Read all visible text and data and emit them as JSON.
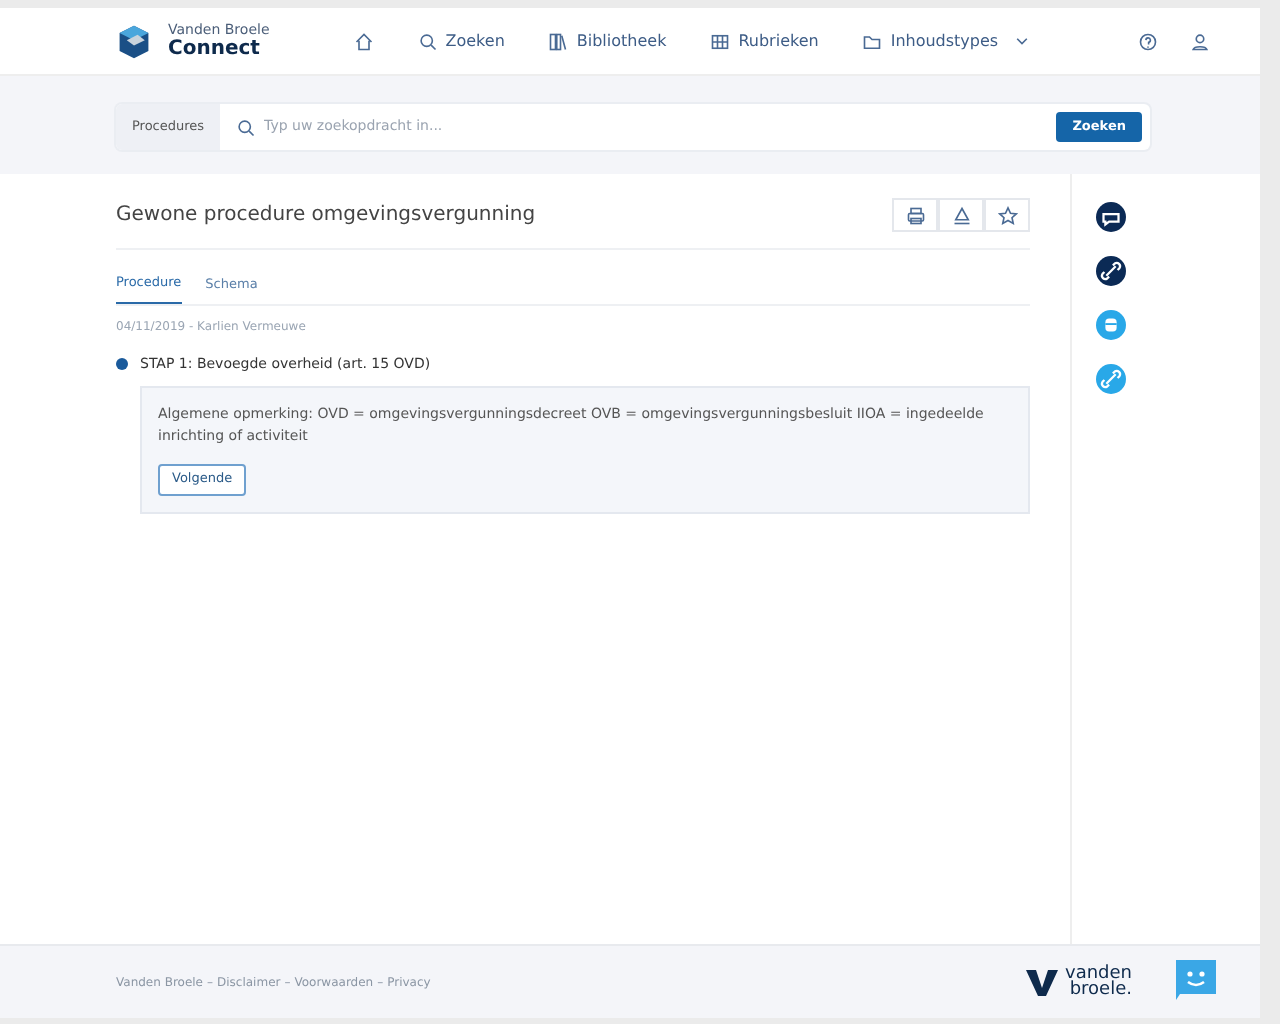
{
  "brand": {
    "line1": "Vanden Broele",
    "line2": "Connect"
  },
  "nav": [
    {
      "kind": "home"
    },
    {
      "kind": "search",
      "label": "Zoeken"
    },
    {
      "kind": "book",
      "label": "Bibliotheek"
    },
    {
      "kind": "grid",
      "label": "Rubrieken"
    },
    {
      "kind": "folder",
      "label": "Inhoudstypes",
      "dropdown": true
    }
  ],
  "search": {
    "scope": "Procedures",
    "placeholder": "Typ uw zoekopdracht in...",
    "button": "Zoeken"
  },
  "document": {
    "title": "Gewone procedure omgevingsvergunning",
    "tabs": [
      {
        "label": "Procedure",
        "selected": true
      },
      {
        "label": "Schema",
        "selected": false
      }
    ],
    "meta": "04/11/2019 - Karlien Vermeuwe",
    "step": {
      "title": "STAP 1: Bevoegde overheid (art. 15 OVD)",
      "note": "Algemene opmerking: OVD = omgevingsvergunningsdecreet OVB = omgevingsvergunningsbesluit IIOA = ingedeelde inrichting of activiteit",
      "button": "Volgende"
    }
  },
  "side_actions": [
    {
      "kind": "comment",
      "color": "#0b2a55"
    },
    {
      "kind": "link",
      "color": "#0b2a55"
    },
    {
      "kind": "database",
      "color": "#29a8e8"
    },
    {
      "kind": "link",
      "color": "#29a8e8"
    }
  ],
  "footer": {
    "links": [
      "Vanden Broele",
      "Disclaimer",
      "Voorwaarden",
      "Privacy"
    ],
    "separators": [
      "–",
      "–",
      "–"
    ],
    "logo": [
      "vanden",
      "broele."
    ]
  }
}
